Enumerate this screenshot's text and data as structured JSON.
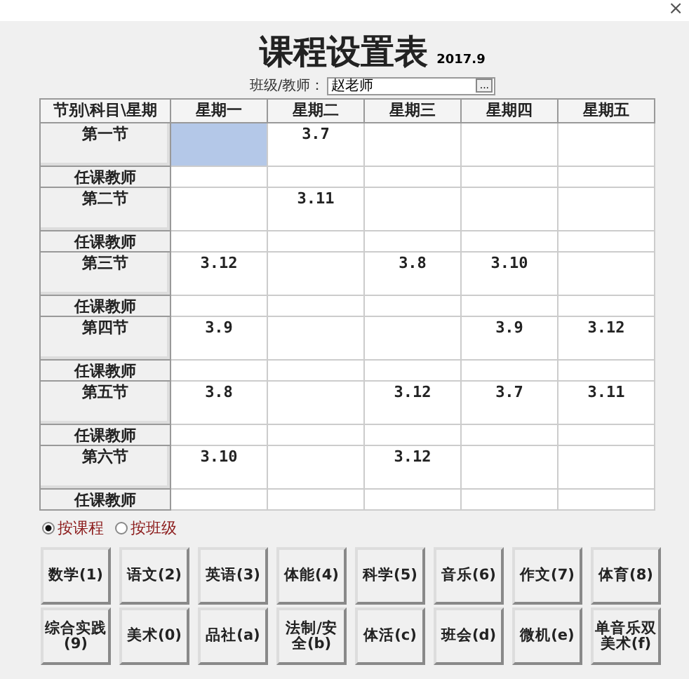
{
  "window": {
    "close": "×"
  },
  "title": "课程设置表",
  "date": "2017.9",
  "selector": {
    "label": "班级/教师：",
    "value": "赵老师",
    "button": "..."
  },
  "table": {
    "columns": [
      "节别\\科目\\星期",
      "星期一",
      "星期二",
      "星期三",
      "星期四",
      "星期五"
    ],
    "rows": [
      {
        "kind": "period",
        "cells": [
          {
            "text": "第一节"
          },
          {
            "text": "",
            "selected": true
          },
          {
            "text": "3.7",
            "selected": false
          },
          {
            "text": "",
            "selected": false
          },
          {
            "text": "",
            "selected": false
          },
          {
            "text": "",
            "selected": false
          }
        ]
      },
      {
        "kind": "teacher",
        "cells": [
          {
            "text": "任课教师"
          },
          {
            "text": ""
          },
          {
            "text": ""
          },
          {
            "text": ""
          },
          {
            "text": ""
          },
          {
            "text": ""
          }
        ]
      },
      {
        "kind": "period",
        "cells": [
          {
            "text": "第二节"
          },
          {
            "text": "",
            "selected": false
          },
          {
            "text": "3.11",
            "selected": false
          },
          {
            "text": "",
            "selected": false
          },
          {
            "text": "",
            "selected": false
          },
          {
            "text": "",
            "selected": false
          }
        ]
      },
      {
        "kind": "teacher",
        "cells": [
          {
            "text": "任课教师"
          },
          {
            "text": ""
          },
          {
            "text": ""
          },
          {
            "text": ""
          },
          {
            "text": ""
          },
          {
            "text": ""
          }
        ]
      },
      {
        "kind": "period",
        "cells": [
          {
            "text": "第三节"
          },
          {
            "text": "3.12",
            "selected": false
          },
          {
            "text": "",
            "selected": false
          },
          {
            "text": "3.8",
            "selected": false
          },
          {
            "text": "3.10",
            "selected": false
          },
          {
            "text": "",
            "selected": false
          }
        ]
      },
      {
        "kind": "teacher",
        "cells": [
          {
            "text": "任课教师"
          },
          {
            "text": ""
          },
          {
            "text": ""
          },
          {
            "text": ""
          },
          {
            "text": ""
          },
          {
            "text": ""
          }
        ]
      },
      {
        "kind": "period",
        "cells": [
          {
            "text": "第四节"
          },
          {
            "text": "3.9",
            "selected": false
          },
          {
            "text": "",
            "selected": false
          },
          {
            "text": "",
            "selected": false
          },
          {
            "text": "3.9",
            "selected": false
          },
          {
            "text": "3.12",
            "selected": false
          }
        ]
      },
      {
        "kind": "teacher",
        "cells": [
          {
            "text": "任课教师"
          },
          {
            "text": ""
          },
          {
            "text": ""
          },
          {
            "text": ""
          },
          {
            "text": ""
          },
          {
            "text": ""
          }
        ]
      },
      {
        "kind": "period",
        "cells": [
          {
            "text": "第五节"
          },
          {
            "text": "3.8",
            "selected": false
          },
          {
            "text": "",
            "selected": false
          },
          {
            "text": "3.12",
            "selected": false
          },
          {
            "text": "3.7",
            "selected": false
          },
          {
            "text": "3.11",
            "selected": false
          }
        ]
      },
      {
        "kind": "teacher",
        "cells": [
          {
            "text": "任课教师"
          },
          {
            "text": ""
          },
          {
            "text": ""
          },
          {
            "text": ""
          },
          {
            "text": ""
          },
          {
            "text": ""
          }
        ]
      },
      {
        "kind": "period",
        "cells": [
          {
            "text": "第六节"
          },
          {
            "text": "3.10",
            "selected": false
          },
          {
            "text": "",
            "selected": false
          },
          {
            "text": "3.12",
            "selected": false
          },
          {
            "text": "",
            "selected": false
          },
          {
            "text": "",
            "selected": false
          }
        ]
      },
      {
        "kind": "teacher",
        "cells": [
          {
            "text": "任课教师"
          },
          {
            "text": ""
          },
          {
            "text": ""
          },
          {
            "text": ""
          },
          {
            "text": ""
          },
          {
            "text": ""
          }
        ]
      }
    ]
  },
  "mode": [
    {
      "label": "按课程",
      "selected": true
    },
    {
      "label": "按班级",
      "selected": false
    }
  ],
  "subject_buttons": [
    [
      "数学(1)",
      "语文(2)",
      "英语(3)",
      "体能(4)",
      "科学(5)",
      "音乐(6)",
      "作文(7)",
      "体育(8)"
    ],
    [
      "综合实践(9)",
      "美术(0)",
      "品社(a)",
      "法制/安全(b)",
      "体活(c)",
      "班会(d)",
      "微机(e)",
      "单音乐双美术(f)"
    ]
  ]
}
